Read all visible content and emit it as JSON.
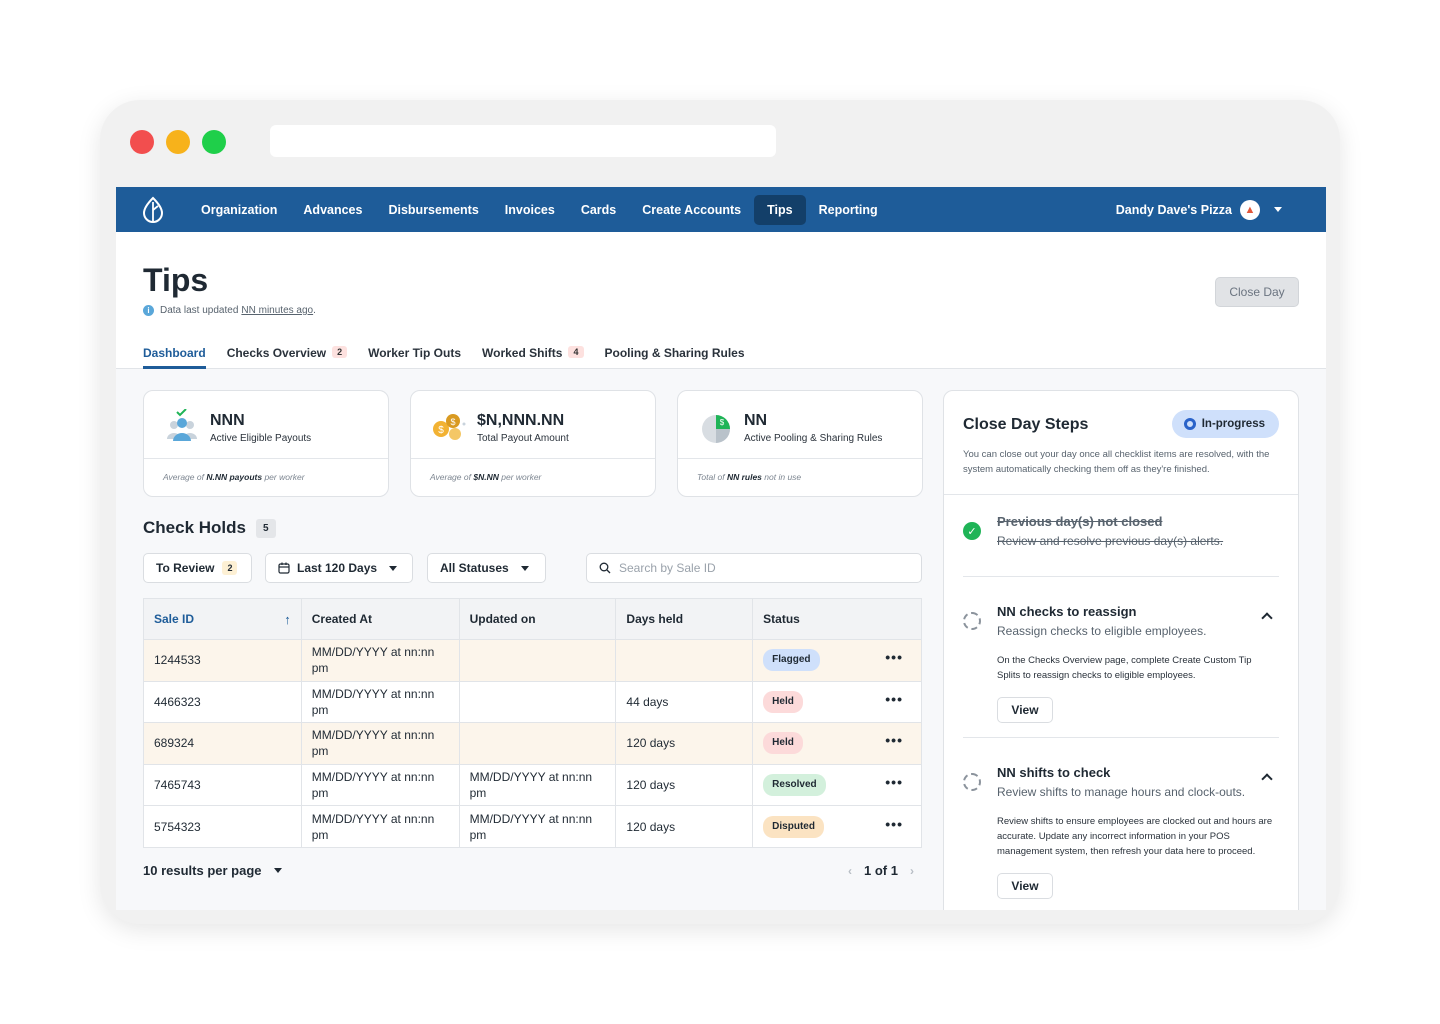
{
  "nav": {
    "items": [
      "Organization",
      "Advances",
      "Disbursements",
      "Invoices",
      "Cards",
      "Create Accounts",
      "Tips",
      "Reporting"
    ],
    "active": "Tips",
    "account_name": "Dandy Dave's Pizza"
  },
  "header": {
    "title": "Tips",
    "updated_prefix": "Data last updated",
    "updated_link": "NN minutes ago",
    "updated_suffix": ".",
    "close_day_label": "Close Day"
  },
  "tabs": [
    {
      "label": "Dashboard",
      "count": ""
    },
    {
      "label": "Checks Overview",
      "count": "2"
    },
    {
      "label": "Worker Tip Outs",
      "count": ""
    },
    {
      "label": "Worked Shifts",
      "count": "4"
    },
    {
      "label": "Pooling & Sharing Rules",
      "count": ""
    }
  ],
  "cards": [
    {
      "value": "NNN",
      "label": "Active Eligible Payouts",
      "foot_pre": "Average of",
      "foot_bold": "N.NN payouts",
      "foot_post": "per worker"
    },
    {
      "value": "$N,NNN.NN",
      "label": "Total Payout Amount",
      "foot_pre": "Average of",
      "foot_bold": "$N.NN",
      "foot_post": "per worker"
    },
    {
      "value": "NN",
      "label": "Active Pooling & Sharing Rules",
      "foot_pre": "Total of",
      "foot_bold": "NN rules",
      "foot_post": "not in use"
    }
  ],
  "check_holds": {
    "title": "Check Holds",
    "count": "5",
    "filters": {
      "to_review": "To Review",
      "to_review_count": "2",
      "date_range": "Last 120 Days",
      "statuses": "All Statuses"
    },
    "search_placeholder": "Search by Sale ID",
    "columns": [
      "Sale ID",
      "Created At",
      "Updated on",
      "Days held",
      "Status"
    ],
    "rows": [
      {
        "sale_id": "1244533",
        "created": "MM/DD/YYYY at nn:nn pm",
        "updated": "",
        "days": "",
        "status": "Flagged",
        "highlight": true
      },
      {
        "sale_id": "4466323",
        "created": "MM/DD/YYYY at nn:nn pm",
        "updated": "",
        "days": "44 days",
        "status": "Held",
        "highlight": false
      },
      {
        "sale_id": "689324",
        "created": "MM/DD/YYYY at nn:nn pm",
        "updated": "",
        "days": "120 days",
        "status": "Held",
        "highlight": true
      },
      {
        "sale_id": "7465743",
        "created": "MM/DD/YYYY at nn:nn pm",
        "updated": "MM/DD/YYYY at nn:nn pm",
        "days": "120 days",
        "status": "Resolved",
        "highlight": false
      },
      {
        "sale_id": "5754323",
        "created": "MM/DD/YYYY at nn:nn pm",
        "updated": "MM/DD/YYYY at nn:nn pm",
        "days": "120 days",
        "status": "Disputed",
        "highlight": false
      }
    ],
    "status_colors": {
      "Flagged": "#cfe0fb",
      "Held": "#fcdada",
      "Resolved": "#d3f0dc",
      "Disputed": "#fbe3c2"
    },
    "per_page": "10 results per page",
    "page_info": "1 of 1"
  },
  "close_day": {
    "title": "Close Day Steps",
    "status": "In-progress",
    "description": "You can close out your day once all checklist items are resolved, with the system automatically checking them off as they're finished.",
    "steps": [
      {
        "title": "Previous day(s) not closed",
        "subtitle": "Review and resolve previous day(s) alerts.",
        "done": true
      },
      {
        "title": "NN checks to reassign",
        "subtitle": "Reassign checks to eligible employees.",
        "body": "On the Checks Overview page, complete Create Custom Tip Splits to reassign checks to eligible employees.",
        "view_label": "View",
        "done": false
      },
      {
        "title": "NN shifts to check",
        "subtitle": "Review shifts to manage hours and clock-outs.",
        "body": "Review shifts to ensure employees are clocked out and hours are accurate. Update any incorrect information in your POS management system, then refresh your data here to proceed.",
        "view_label": "View",
        "done": false
      }
    ]
  },
  "colors": {
    "nav": "#1e5c99",
    "nav_active": "#133f69",
    "accent": "#1e5c99",
    "success": "#1fb457"
  }
}
